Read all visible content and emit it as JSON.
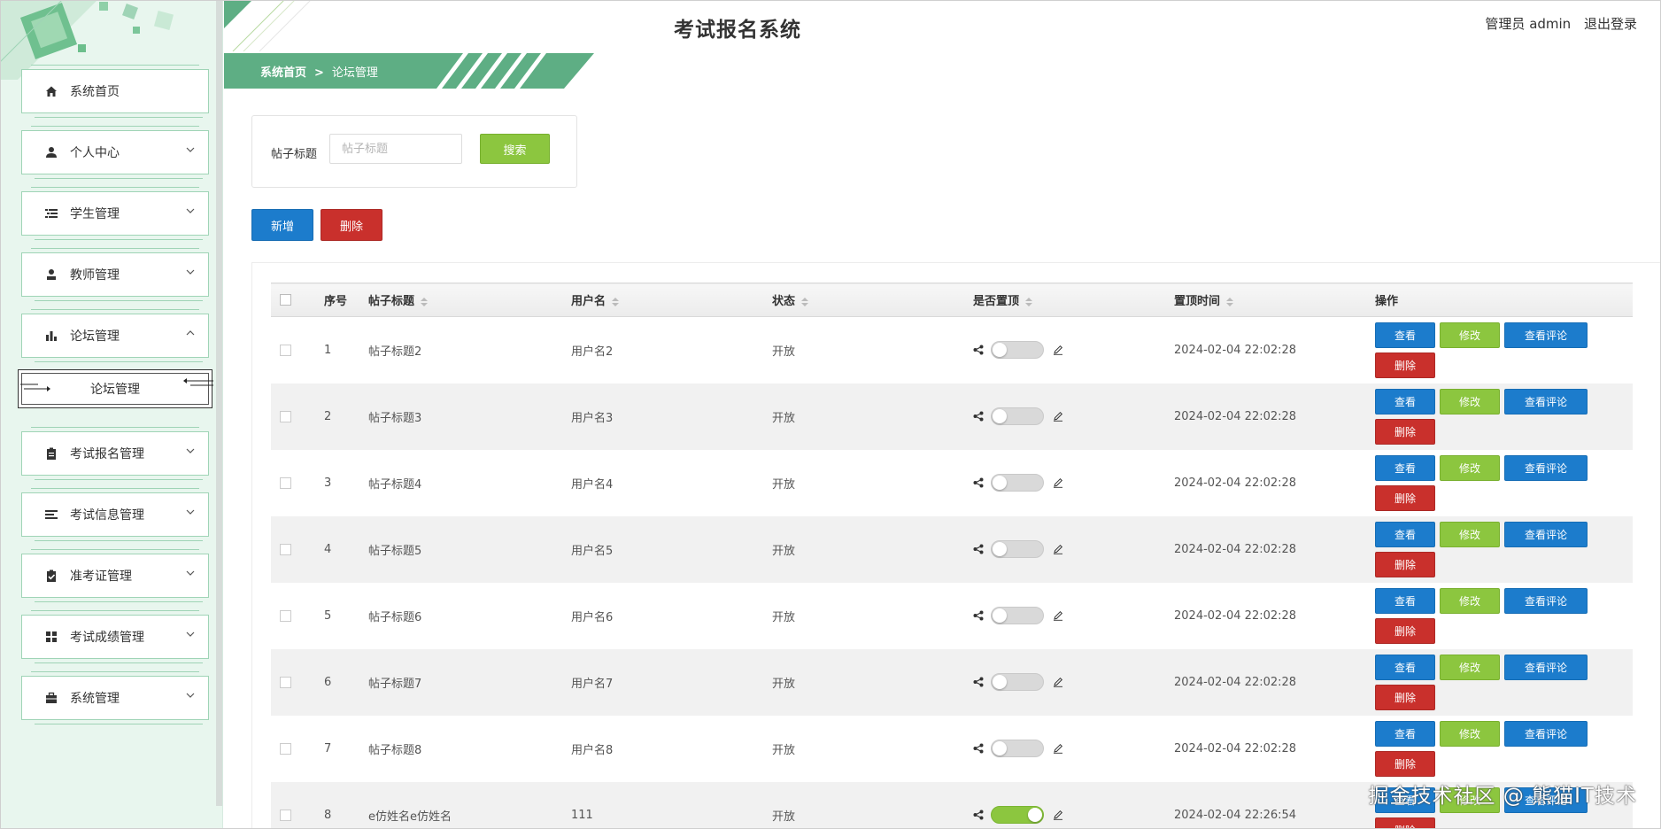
{
  "app": {
    "title": "考试报名系统"
  },
  "user": {
    "label": "管理员 admin",
    "logout": "退出登录"
  },
  "sidebar": {
    "items": [
      {
        "label": "系统首页",
        "icon": "home-icon",
        "expandable": false
      },
      {
        "label": "个人中心",
        "icon": "person-icon",
        "expandable": true
      },
      {
        "label": "学生管理",
        "icon": "list-icon",
        "expandable": true
      },
      {
        "label": "教师管理",
        "icon": "teacher-icon",
        "expandable": true
      },
      {
        "label": "论坛管理",
        "icon": "bar-chart-icon",
        "expandable": true,
        "expanded": true
      },
      {
        "label": "考试报名管理",
        "icon": "clipboard-icon",
        "expandable": true
      },
      {
        "label": "考试信息管理",
        "icon": "lines-icon",
        "expandable": true
      },
      {
        "label": "准考证管理",
        "icon": "clipboard-check-icon",
        "expandable": true
      },
      {
        "label": "考试成绩管理",
        "icon": "grid-icon",
        "expandable": true
      },
      {
        "label": "系统管理",
        "icon": "briefcase-icon",
        "expandable": true
      }
    ],
    "submenu": {
      "label": "论坛管理"
    }
  },
  "breadcrumb": {
    "home": "系统首页",
    "separator": ">",
    "current": "论坛管理"
  },
  "search": {
    "label": "帖子标题",
    "placeholder": "帖子标题",
    "value": "",
    "button": "搜索"
  },
  "actions": {
    "add": "新增",
    "delete": "删除"
  },
  "table": {
    "columns": [
      "序号",
      "帖子标题",
      "用户名",
      "状态",
      "是否置顶",
      "置顶时间",
      "操作"
    ],
    "op_labels": {
      "view": "查看",
      "edit": "修改",
      "comments": "查看评论",
      "delete": "删除"
    },
    "rows": [
      {
        "no": "1",
        "title": "帖子标题2",
        "user": "用户名2",
        "status": "开放",
        "pinned": false,
        "time": "2024-02-04 22:02:28"
      },
      {
        "no": "2",
        "title": "帖子标题3",
        "user": "用户名3",
        "status": "开放",
        "pinned": false,
        "time": "2024-02-04 22:02:28"
      },
      {
        "no": "3",
        "title": "帖子标题4",
        "user": "用户名4",
        "status": "开放",
        "pinned": false,
        "time": "2024-02-04 22:02:28"
      },
      {
        "no": "4",
        "title": "帖子标题5",
        "user": "用户名5",
        "status": "开放",
        "pinned": false,
        "time": "2024-02-04 22:02:28"
      },
      {
        "no": "5",
        "title": "帖子标题6",
        "user": "用户名6",
        "status": "开放",
        "pinned": false,
        "time": "2024-02-04 22:02:28"
      },
      {
        "no": "6",
        "title": "帖子标题7",
        "user": "用户名7",
        "status": "开放",
        "pinned": false,
        "time": "2024-02-04 22:02:28"
      },
      {
        "no": "7",
        "title": "帖子标题8",
        "user": "用户名8",
        "status": "开放",
        "pinned": false,
        "time": "2024-02-04 22:02:28"
      },
      {
        "no": "8",
        "title": "e仿姓名e仿姓名",
        "user": "111",
        "status": "开放",
        "pinned": true,
        "time": "2024-02-04 22:26:54"
      }
    ]
  },
  "watermark": "掘金技术社区 @ 熊猫IT技术",
  "colors": {
    "primary": "#1c7ccc",
    "success": "#8cc63f",
    "danger": "#c9302c",
    "sidebar_bg": "#e8f6ee",
    "accent_green": "#5eae84"
  }
}
